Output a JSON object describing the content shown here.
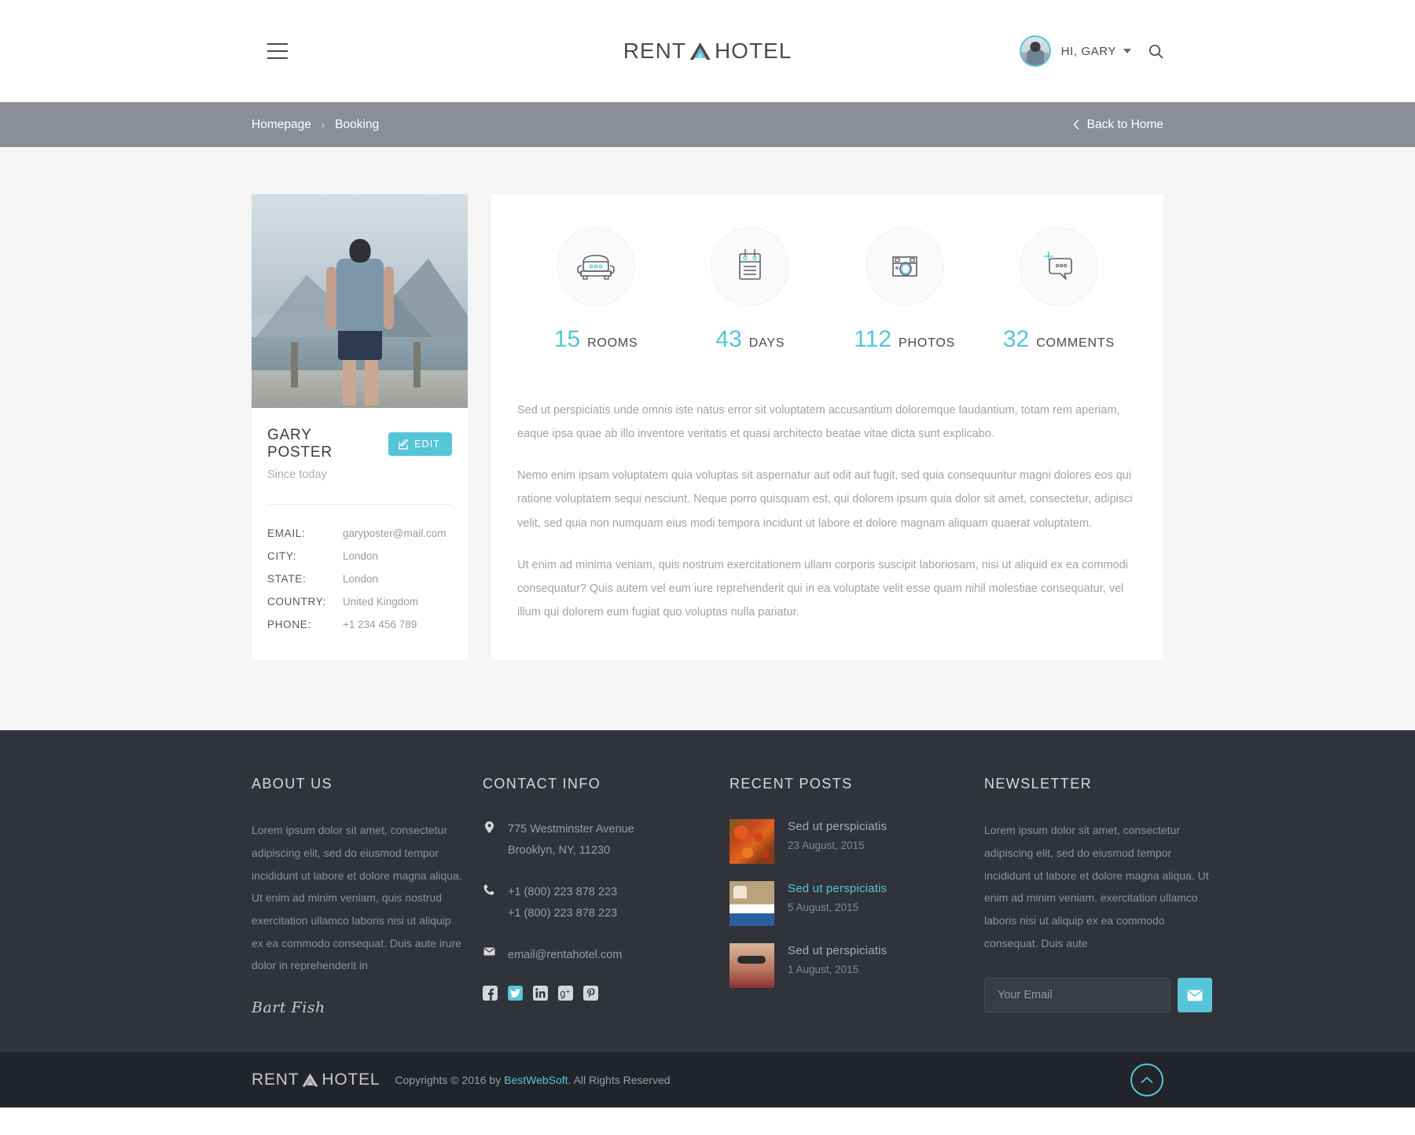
{
  "header": {
    "menu_icon": "hamburger-icon",
    "logo": {
      "part1": "RENT",
      "part2": "HOTEL",
      "mark": "mountain-triangle-icon"
    },
    "user": {
      "greeting": "HI, GARY",
      "avatar": "user-avatar"
    },
    "search_icon": "search-icon"
  },
  "breadcrumb": {
    "items": [
      {
        "label": "Homepage"
      },
      {
        "label": "Booking"
      }
    ],
    "separator": "›",
    "back_label": "Back to Home",
    "back_icon": "chevron-left-icon"
  },
  "profile": {
    "photo_alt": "man standing by mountain lake",
    "name": "GARY POSTER",
    "edit_label": "EDIT",
    "edit_icon": "pencil-square-icon",
    "since": "Since today",
    "info": [
      {
        "label": "EMAIL:",
        "value": "garyposter@mail.com"
      },
      {
        "label": "CITY:",
        "value": "London"
      },
      {
        "label": "STATE:",
        "value": "London"
      },
      {
        "label": "COUNTRY:",
        "value": "United Kingdom"
      },
      {
        "label": "PHONE:",
        "value": "+1 234 456 789"
      }
    ]
  },
  "stats": [
    {
      "num": "15",
      "label": "ROOMS",
      "icon": "sofa-icon"
    },
    {
      "num": "43",
      "label": "DAYS",
      "icon": "calendar-icon"
    },
    {
      "num": "112",
      "label": "PHOTOS",
      "icon": "camera-icon"
    },
    {
      "num": "32",
      "label": "COMMENTS",
      "icon": "comment-plus-icon"
    }
  ],
  "content": {
    "p1": "Sed ut perspiciatis unde omnis iste natus error sit voluptatem accusantium doloremque laudantium, totam rem aperiam, eaque ipsa quae ab illo inventore veritatis et quasi architecto beatae vitae dicta sunt explicabo.",
    "p2": "Nemo enim ipsam voluptatem quia voluptas sit aspernatur aut odit aut fugit, sed quia consequuntur magni dolores eos qui ratione voluptatem sequi nesciunt. Neque porro quisquam est, qui dolorem ipsum quia dolor sit amet, consectetur, adipisci velit, sed quia non numquam eius modi tempora incidunt ut labore et dolore magnam aliquam quaerat voluptatem.",
    "p3": "Ut enim ad minima veniam, quis nostrum exercitationem ullam corporis suscipit laboriosam, nisi ut aliquid ex ea commodi consequatur? Quis autem vel eum iure reprehenderit qui in ea voluptate velit esse quam nihil molestiae consequatur, vel illum qui dolorem eum fugiat quo voluptas nulla pariatur."
  },
  "footer": {
    "about": {
      "title": "ABOUT US",
      "text": "Lorem ipsum dolor sit amet, consectetur adipiscing elit, sed do eiusmod tempor incididunt ut labore et dolore magna aliqua. Ut enim ad minim veniam, quis nostrud exercitation ullamco laboris nisi ut aliquip ex ea commodo consequat. Duis aute irure dolor in reprehenderit in",
      "signature": "Bart Fish"
    },
    "contact": {
      "title": "CONTACT INFO",
      "address_line1": "775 Westminster Avenue",
      "address_line2": "Brooklyn, NY, 11230",
      "phone1": "+1 (800) 223 878 223",
      "phone2": "+1 (800) 223 878 223",
      "email": "email@rentahotel.com",
      "icons": {
        "address": "map-pin-icon",
        "phone": "phone-icon",
        "email": "envelope-icon"
      },
      "socials": [
        {
          "name": "facebook-icon",
          "glyph": "f",
          "active": false
        },
        {
          "name": "twitter-icon",
          "glyph": "t",
          "active": true
        },
        {
          "name": "linkedin-icon",
          "glyph": "in",
          "active": false
        },
        {
          "name": "google-plus-icon",
          "glyph": "g+",
          "active": false
        },
        {
          "name": "pinterest-icon",
          "glyph": "p",
          "active": false
        }
      ]
    },
    "posts": {
      "title": "RECENT POSTS",
      "items": [
        {
          "title": "Sed ut perspiciatis",
          "date": "23 August, 2015",
          "thumb": "flowers",
          "active": false
        },
        {
          "title": "Sed ut perspiciatis",
          "date": "5 August, 2015",
          "thumb": "room",
          "active": true
        },
        {
          "title": "Sed ut perspiciatis",
          "date": "1 August, 2015",
          "thumb": "lady",
          "active": false
        }
      ]
    },
    "newsletter": {
      "title": "NEWSLETTER",
      "text": "Lorem ipsum dolor sit amet, consectetur adipiscing elit, sed do eiusmod tempor incididunt ut labore et dolore magna aliqua. Ut enim ad minim veniam. exercitation ullamco laboris nisi ut aliquip ex ea commodo consequat. Duis aute",
      "placeholder": "Your Email",
      "input_value": "",
      "submit_icon": "envelope-icon"
    }
  },
  "copyright": {
    "logo": {
      "part1": "RENT",
      "part2": "HOTEL"
    },
    "pre": "Copyrights © 2016 by ",
    "brand": "BestWebSoft",
    "post": ". All Rights Reserved",
    "totop_icon": "chevron-up-icon"
  },
  "colors": {
    "accent": "#56c5d8",
    "breadcrumb_bg": "#8b8d97",
    "footer_bg": "#30333a",
    "copybar_bg": "#21242a",
    "page_bg": "#f5f5f5"
  }
}
